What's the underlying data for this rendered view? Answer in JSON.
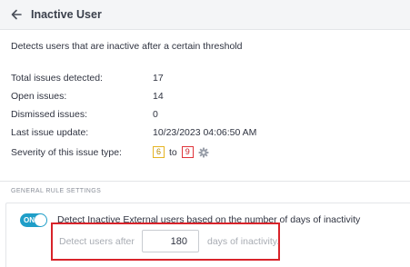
{
  "header": {
    "title": "Inactive User",
    "back_icon": "arrow-left-icon"
  },
  "description": "Detects users that are inactive after a certain threshold",
  "stats": {
    "total_label": "Total issues detected:",
    "total_value": "17",
    "open_label": "Open issues:",
    "open_value": "14",
    "dismissed_label": "Dismissed issues:",
    "dismissed_value": "0",
    "last_update_label": "Last issue update:",
    "last_update_value": "10/23/2023 04:06:50 AM",
    "severity_label": "Severity of this issue type:",
    "severity_from": "6",
    "severity_to_word": "to",
    "severity_to": "9",
    "severity_from_color": "#e6b422",
    "severity_to_color": "#e0343a"
  },
  "general_rule": {
    "section_title": "GENERAL RULE SETTINGS",
    "toggle_label": "ON",
    "toggle_color": "#1f9ec8",
    "rule_text": "Detect Inactive External users based on the number of days of inactivity",
    "detect_after_label": "Detect users after",
    "days_value": "180",
    "days_suffix": "days of inactivity.",
    "highlight_color": "#d8232a"
  }
}
